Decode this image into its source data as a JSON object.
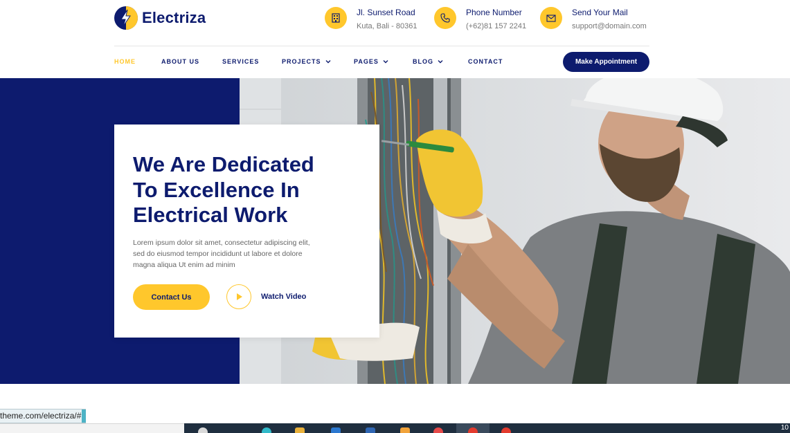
{
  "brand": {
    "name": "Electriza"
  },
  "contact_info": [
    {
      "icon": "building-icon",
      "title": "Jl. Sunset Road",
      "detail": "Kuta, Bali - 80361"
    },
    {
      "icon": "phone-icon",
      "title": "Phone Number",
      "detail": "(+62)81 157 2241"
    },
    {
      "icon": "mail-icon",
      "title": "Send Your Mail",
      "detail": "support@domain.com"
    }
  ],
  "nav": [
    {
      "label": "HOME",
      "active": true
    },
    {
      "label": "ABOUT US"
    },
    {
      "label": "SERVICES"
    },
    {
      "label": "PROJECTS",
      "dropdown": true
    },
    {
      "label": "PAGES",
      "dropdown": true
    },
    {
      "label": "BLOG",
      "dropdown": true
    },
    {
      "label": "CONTACT"
    }
  ],
  "cta": {
    "appointment": "Make Appointment"
  },
  "hero": {
    "heading_lines": [
      "We Are Dedicated",
      "To Excellence In",
      "Electrical Work"
    ],
    "text_lines": [
      "Lorem ipsum dolor sit amet, consectetur adipiscing elit,",
      "sed do eiusmod tempor incididunt ut labore et dolore",
      "magna aliqua Ut enim ad minim"
    ],
    "contact_button": "Contact Us",
    "watch_label": "Watch Video"
  },
  "browser": {
    "status_url": "theme.com/electriza/#",
    "clock": "10"
  },
  "colors": {
    "primary": "#0d1b6e",
    "accent": "#ffc72c"
  }
}
